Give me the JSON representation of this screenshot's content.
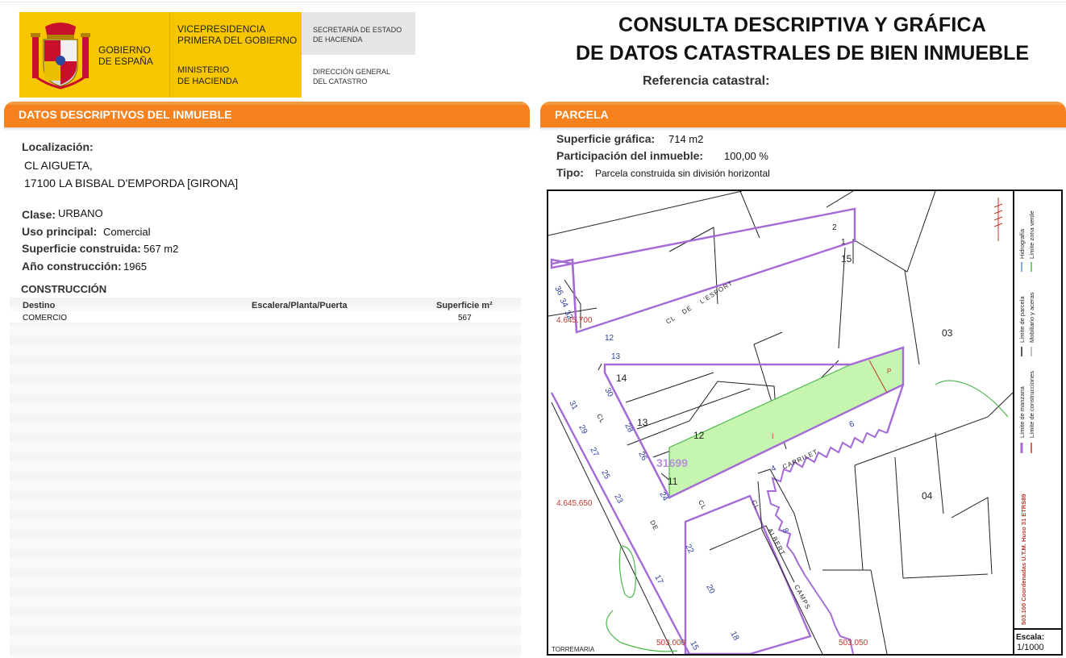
{
  "header": {
    "gobierno": "GOBIERNO\nDE ESPAÑA",
    "vicepresidencia": "VICEPRESIDENCIA\nPRIMERA DEL GOBIERNO",
    "ministerio": "MINISTERIO\nDE HACIENDA",
    "secretaria": "SECRETARÍA DE ESTADO\nDE HACIENDA",
    "direccion": "DIRECCIÓN GENERAL\nDEL CATASTRO",
    "title_line1": "CONSULTA DESCRIPTIVA Y GRÁFICA",
    "title_line2": "DE DATOS CATASTRALES DE BIEN INMUEBLE",
    "ref_label": "Referencia catastral:"
  },
  "descriptivos": {
    "section_title": "DATOS DESCRIPTIVOS DEL INMUEBLE",
    "localizacion_label": "Localización:",
    "address_line1": "CL AIGUETA,",
    "address_line2": "17100 LA BISBAL D'EMPORDA [GIRONA]",
    "clase_label": "Clase:",
    "clase_value": "URBANO",
    "uso_label": "Uso principal:",
    "uso_value": "Comercial",
    "superficie_label": "Superficie construida:",
    "superficie_value": "567 m2",
    "anio_label": "Año construcción:",
    "anio_value": "1965",
    "construccion_title": "CONSTRUCCIÓN",
    "table": {
      "headers": [
        "Destino",
        "Escalera/Planta/Puerta",
        "Superficie m²"
      ],
      "rows": [
        [
          "COMERCIO",
          "",
          "567"
        ]
      ]
    }
  },
  "parcela": {
    "section_title": "PARCELA",
    "superficie_label": "Superficie gráfica:",
    "superficie_value": "714 m2",
    "participacion_label": "Participación del inmueble:",
    "participacion_value": "100,00 %",
    "tipo_label": "Tipo:",
    "tipo_value": "Parcela construida sin división horizontal"
  },
  "map": {
    "parcel_code": "31699",
    "coordinates": [
      "4.645.700",
      "4.645.650",
      "503.000",
      "503.050"
    ],
    "block_labels": [
      "15",
      "03",
      "04",
      "14",
      "13",
      "12",
      "11",
      "2",
      "1"
    ],
    "plot_marks": [
      "I",
      "P"
    ],
    "street_texts": [
      "CL",
      "DE",
      "L'ESPORT",
      "CARRILET",
      "ALBERT",
      "CAMPS",
      "TORREMARIA"
    ],
    "street_numbers": [
      "36",
      "34",
      "32",
      "12",
      "13",
      "30",
      "28",
      "26",
      "24",
      "31",
      "29",
      "27",
      "25",
      "23",
      "17",
      "15",
      "22",
      "20",
      "18",
      "6",
      "4",
      "8"
    ],
    "legend": {
      "items": [
        "Límite de manzana",
        "Límite de parcela",
        "Límite de construcciones",
        "Mobiliario y aceras",
        "Límite zona verde",
        "Hidrografía"
      ],
      "coords_note": "503.100 Coordenadas U.T.M. Huso 31 ETRS89",
      "scale_label": "Escala:",
      "scale_value": "1/1000"
    },
    "colors": {
      "parcel_fill": "#c6f5b0",
      "block_line": "#a46bd6",
      "green_zone": "#4cb84c",
      "coords": "#c0392b"
    }
  }
}
